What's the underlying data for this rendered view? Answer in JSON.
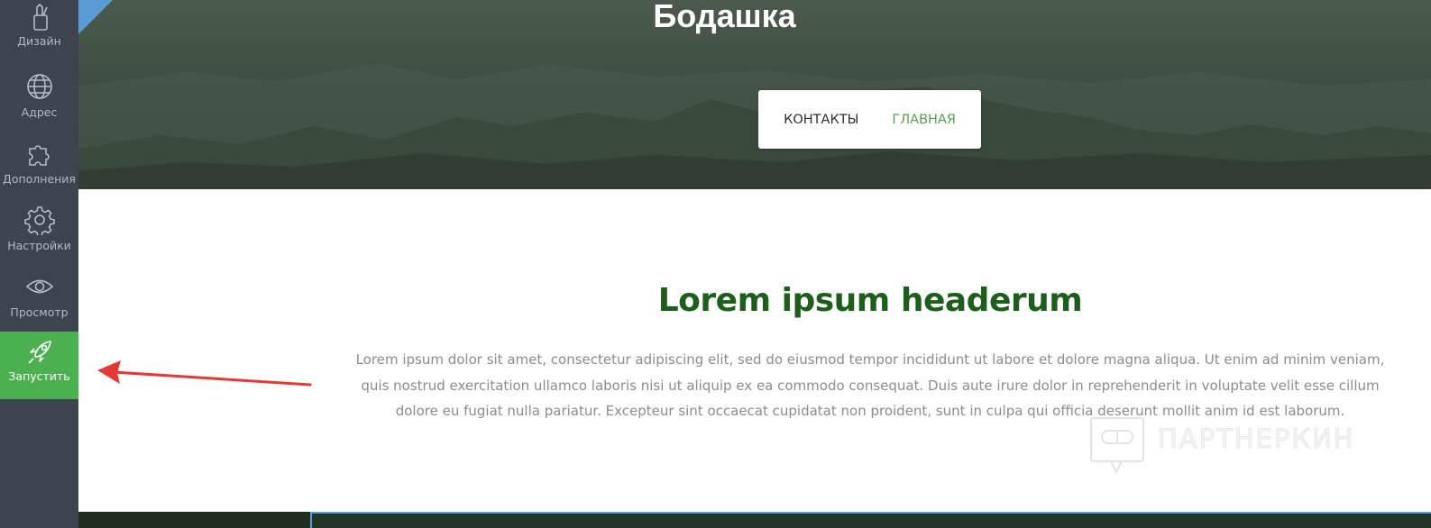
{
  "sidebar": {
    "items": [
      {
        "label": "Дизайн",
        "icon": "design-tools-icon"
      },
      {
        "label": "Адрес",
        "icon": "globe-icon"
      },
      {
        "label": "Дополнения",
        "icon": "puzzle-icon"
      },
      {
        "label": "Настройки",
        "icon": "gear-icon"
      },
      {
        "label": "Просмотр",
        "icon": "eye-icon"
      },
      {
        "label": "Запустить",
        "icon": "rocket-icon"
      }
    ],
    "active_color": "#4caf50",
    "background": "#3d4450"
  },
  "site": {
    "title": "Бодашка",
    "nav": {
      "contacts": "КОНТАКТЫ",
      "home": "ГЛАВНАЯ"
    }
  },
  "content": {
    "heading": "Lorem ipsum headerum",
    "paragraph": "Lorem ipsum dolor sit amet, consectetur adipiscing elit, sed do eiusmod tempor incididunt ut labore et dolore magna aliqua. Ut enim ad minim veniam, quis nostrud exercitation ullamco laboris nisi ut aliquip ex ea commodo consequat. Duis aute irure dolor in reprehenderit in voluptate velit esse cillum dolore eu fugiat nulla pariatur. Excepteur sint occaecat cupidatat non proident, sunt in culpa qui officia deserunt mollit anim id est laborum."
  },
  "watermark": {
    "text": "ПАРТНЕРКИН"
  },
  "colors": {
    "heading": "#1d5e1d",
    "nav_current": "#5a9e55",
    "arrow": "#e53935"
  }
}
